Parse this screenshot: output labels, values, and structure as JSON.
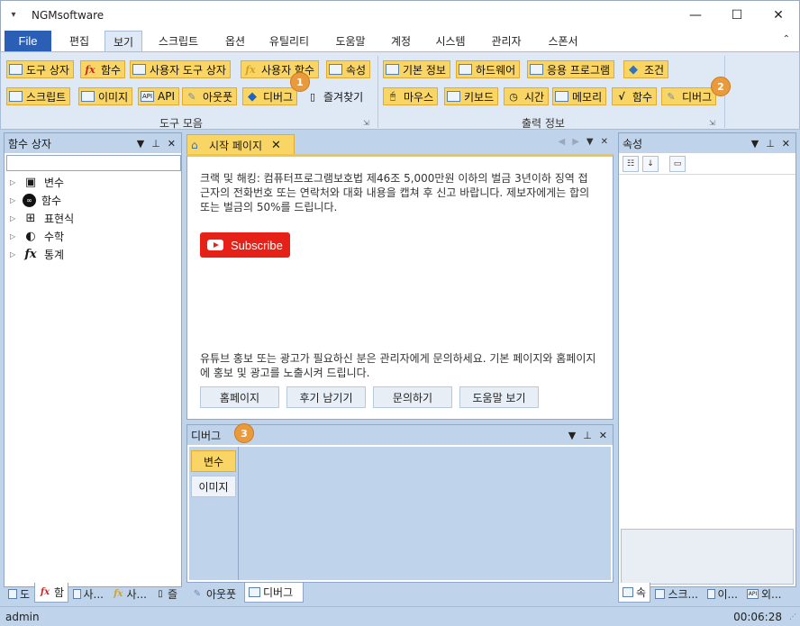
{
  "window": {
    "title": "NGMsoftware",
    "minimize": "—",
    "maximize": "☐",
    "close": "✕"
  },
  "menu": {
    "file": "File",
    "tabs": [
      "편집",
      "보기",
      "스크립트",
      "옵션",
      "유틸리티",
      "도움말",
      "계정",
      "시스템",
      "관리자",
      "스폰서"
    ],
    "active_tab": "보기"
  },
  "ribbon": {
    "tools_group": {
      "label": "도구 모음",
      "row1": [
        "도구 상자",
        "함수",
        "사용자 도구 상자",
        "사용자 함수",
        "속성"
      ],
      "row2": [
        "스크립트",
        "이미지",
        "API",
        "아웃풋",
        "디버그",
        "즐겨찾기"
      ]
    },
    "output_group": {
      "label": "출력 정보",
      "row1": [
        "기본 정보",
        "하드웨어",
        "응용 프로그램",
        "조건"
      ],
      "row2": [
        "마우스",
        "키보드",
        "시간",
        "메모리",
        "함수",
        "디버그"
      ]
    },
    "badges": [
      "1",
      "2",
      "3"
    ]
  },
  "left_panel": {
    "title": "함수 상자",
    "tree": [
      "변수",
      "함수",
      "표현식",
      "수학",
      "통계"
    ],
    "bottom_tabs": [
      "도",
      "함",
      "사...",
      "사...",
      "즐"
    ]
  },
  "start_page": {
    "tab_label": "시작 페이지",
    "notice": "크랙 및 해킹: 컴퓨터프로그램보호법 제46조 5,000만원 이하의 벌금 3년이하 징역 접근자의 전화번호 또는 연락처와 대화 내용을 캡쳐 후 신고 바랍니다. 제보자에게는 합의 또는 벌금의 50%를 드립니다.",
    "subscribe": "Subscribe",
    "promo": "유튜브 홍보 또는 광고가 필요하신 분은 관리자에게 문의하세요. 기본 페이지와 홈페이지에 홍보 및 광고를 노출시켜 드립니다.",
    "buttons": [
      "홈페이지",
      "후기 남기기",
      "문의하기",
      "도움말 보기"
    ]
  },
  "debug_panel": {
    "title": "디버그",
    "tabs": [
      "변수",
      "이미지"
    ],
    "bottom_tabs": [
      "아웃풋",
      "디버그"
    ]
  },
  "right_panel": {
    "title": "속성",
    "bottom_tabs": [
      "속",
      "스크...",
      "이...",
      "외..."
    ]
  },
  "status": {
    "user": "admin",
    "time": "00:06:28"
  },
  "colors": {
    "accent": "#f9d565",
    "file_tab": "#2b5fb5",
    "panel_bg": "#bfd3ea",
    "youtube": "#e62117",
    "badge": "#e89a3c"
  }
}
